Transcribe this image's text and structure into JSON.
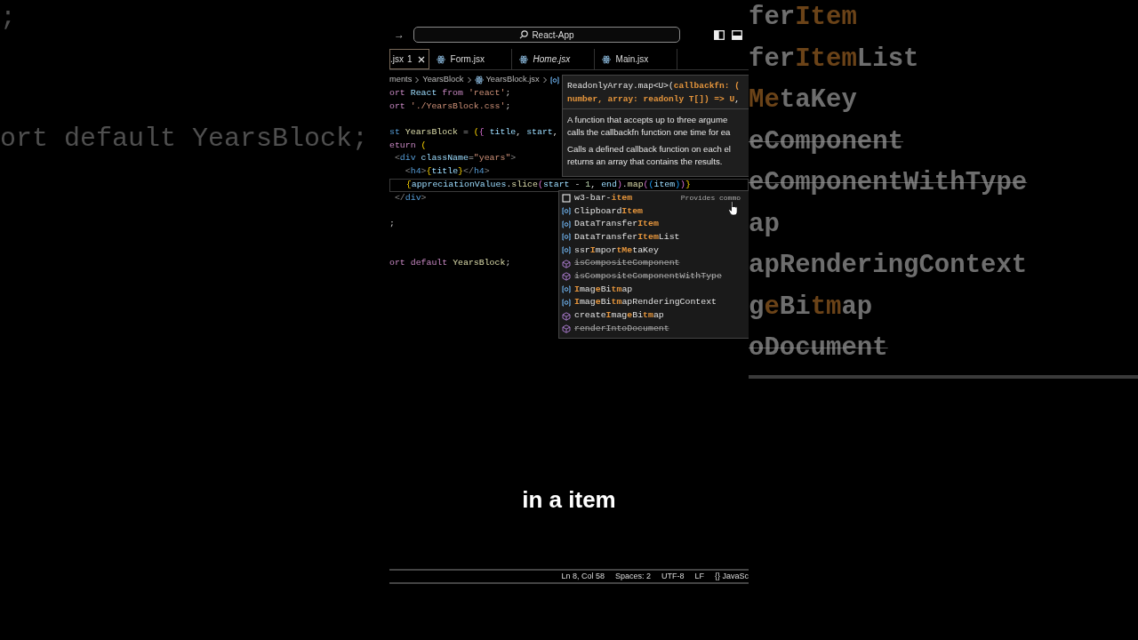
{
  "background_left": {
    "lines": [
      ";",
      "ort default YearsBlock;"
    ]
  },
  "background_right": {
    "lines": [
      {
        "segments": [
          {
            "text": "fer"
          },
          {
            "text": "Item",
            "match": true
          }
        ]
      },
      {
        "segments": [
          {
            "text": "fer"
          },
          {
            "text": "Item",
            "match": true
          },
          {
            "text": "List"
          }
        ]
      },
      {
        "segments": [
          {
            "text": "Me",
            "match": true
          },
          {
            "text": "taKey"
          }
        ]
      },
      {
        "segments": [
          {
            "text": "eComponent"
          }
        ],
        "deprecated": true
      },
      {
        "segments": [
          {
            "text": "eComponentWithType"
          }
        ],
        "deprecated": true
      },
      {
        "segments": [
          {
            "text": "ap"
          }
        ]
      },
      {
        "segments": [
          {
            "text": "apRenderingContext"
          }
        ]
      },
      {
        "segments": [
          {
            "text": "g"
          },
          {
            "text": "e",
            "match": true
          },
          {
            "text": "Bi"
          },
          {
            "text": "tm",
            "match": true
          },
          {
            "text": "ap"
          }
        ]
      },
      {
        "segments": [
          {
            "text": "oDocument"
          }
        ],
        "deprecated": true
      }
    ]
  },
  "title_bar": {
    "back": "→",
    "search": "React-App"
  },
  "tabs": [
    {
      "label": ".jsx",
      "problems": "1",
      "selected": true
    },
    {
      "label": "Form.jsx",
      "selected": false
    },
    {
      "label": "Home.jsx",
      "selected": false,
      "preview": true
    },
    {
      "label": "Main.jsx",
      "selected": false
    }
  ],
  "breadcrumb": [
    {
      "text": "ments"
    },
    {
      "text": "YearsBlock"
    },
    {
      "text": "YearsBlock.jsx",
      "kind": "file"
    }
  ],
  "code": [
    {
      "kind": "code",
      "segments": [
        {
          "kind": "control",
          "text": "ort"
        },
        {
          "kind": "variable",
          "text": " React"
        },
        {
          "kind": "control",
          "text": " from"
        },
        {
          "kind": "string",
          "text": " 'react'"
        },
        {
          "kind": "plain",
          "text": ";"
        }
      ]
    },
    {
      "kind": "code",
      "segments": [
        {
          "kind": "control",
          "text": "ort"
        },
        {
          "kind": "string",
          "text": " './YearsBlock.css'"
        },
        {
          "kind": "plain",
          "text": ";"
        }
      ]
    },
    {
      "kind": "blank"
    },
    {
      "kind": "code",
      "segments": [
        {
          "kind": "keyword",
          "text": "st"
        },
        {
          "kind": "function",
          "text": " YearsBlock"
        },
        {
          "kind": "plain",
          "text": " ="
        },
        {
          "kind": "bracket",
          "text": " ("
        },
        {
          "kind": "brace",
          "text": "{"
        },
        {
          "kind": "variable",
          "text": " title"
        },
        {
          "kind": "plain",
          "text": ","
        },
        {
          "kind": "variable",
          "text": " start"
        },
        {
          "kind": "plain",
          "text": ","
        }
      ]
    },
    {
      "kind": "code",
      "segments": [
        {
          "kind": "control",
          "text": "eturn"
        },
        {
          "kind": "bracket",
          "text": " ("
        }
      ]
    },
    {
      "kind": "code",
      "segments": [
        {
          "kind": "punct",
          "text": " <"
        },
        {
          "kind": "tag",
          "text": "div"
        },
        {
          "kind": "variable",
          "text": " className"
        },
        {
          "kind": "plain",
          "text": "="
        },
        {
          "kind": "string",
          "text": "\"years\""
        },
        {
          "kind": "punct",
          "text": ">"
        }
      ]
    },
    {
      "kind": "code",
      "segments": [
        {
          "kind": "punct",
          "text": "   <"
        },
        {
          "kind": "tag",
          "text": "h4"
        },
        {
          "kind": "punct",
          "text": ">"
        },
        {
          "kind": "bracket",
          "text": "{"
        },
        {
          "kind": "variable",
          "text": "title"
        },
        {
          "kind": "bracket",
          "text": "}"
        },
        {
          "kind": "punct",
          "text": "</"
        },
        {
          "kind": "tag",
          "text": "h4"
        },
        {
          "kind": "punct",
          "text": ">"
        }
      ]
    },
    {
      "kind": "code",
      "current": true,
      "segments": [
        {
          "kind": "bracket",
          "text": "   {"
        },
        {
          "kind": "variable",
          "text": "appreciationValues"
        },
        {
          "kind": "plain",
          "text": "."
        },
        {
          "kind": "function",
          "text": "slice"
        },
        {
          "kind": "brace",
          "text": "("
        },
        {
          "kind": "variable",
          "text": "start"
        },
        {
          "kind": "plain",
          "text": " -"
        },
        {
          "kind": "number",
          "text": " 1"
        },
        {
          "kind": "plain",
          "text": ","
        },
        {
          "kind": "variable",
          "text": " end"
        },
        {
          "kind": "brace",
          "text": ")"
        },
        {
          "kind": "plain",
          "text": "."
        },
        {
          "kind": "function",
          "text": "map"
        },
        {
          "kind": "brace",
          "text": "("
        },
        {
          "kind": "paren",
          "text": "("
        },
        {
          "kind": "variable",
          "text": "item"
        },
        {
          "kind": "paren",
          "text": ")"
        },
        {
          "kind": "brace",
          "text": ")"
        },
        {
          "kind": "bracket",
          "text": "}"
        }
      ]
    },
    {
      "kind": "code",
      "segments": [
        {
          "kind": "punct",
          "text": " </"
        },
        {
          "kind": "tag",
          "text": "div"
        },
        {
          "kind": "punct",
          "text": ">"
        }
      ]
    },
    {
      "kind": "blank"
    },
    {
      "kind": "code",
      "segments": [
        {
          "kind": "plain",
          "text": ";"
        }
      ]
    },
    {
      "kind": "blank"
    },
    {
      "kind": "blank"
    },
    {
      "kind": "code",
      "segments": [
        {
          "kind": "control",
          "text": "ort"
        },
        {
          "kind": "control",
          "text": " default"
        },
        {
          "kind": "function",
          "text": " YearsBlock"
        },
        {
          "kind": "plain",
          "text": ";"
        }
      ]
    }
  ],
  "hover": {
    "signature": [
      [
        {
          "text": "ReadonlyArray.map<U>("
        },
        {
          "text": "callbackfn: (",
          "active": true
        }
      ],
      [
        {
          "text": "number, array: readonly T[]) => U",
          "active": true
        },
        {
          "text": ","
        }
      ]
    ],
    "paragraphs": [
      {
        "lines": [
          "A function that accepts up to three argume",
          "calls the callbackfn function one time for ea"
        ]
      },
      {
        "lines": [
          "Calls a defined callback function on each el",
          "returns an array that contains the results."
        ]
      }
    ]
  },
  "suggestions": [
    {
      "kind": "css",
      "segments": [
        {
          "text": "w3-bar-"
        },
        {
          "text": "item",
          "match": true
        }
      ],
      "detail": "Provides commo",
      "deprecated": false
    },
    {
      "kind": "variable",
      "segments": [
        {
          "text": "Clipboard"
        },
        {
          "text": "Item",
          "match": true
        }
      ],
      "deprecated": false
    },
    {
      "kind": "variable",
      "segments": [
        {
          "text": "DataTransfer"
        },
        {
          "text": "Item",
          "match": true
        }
      ],
      "deprecated": false
    },
    {
      "kind": "variable",
      "segments": [
        {
          "text": "DataTransfer"
        },
        {
          "text": "Item",
          "match": true
        },
        {
          "text": "List"
        }
      ],
      "deprecated": false
    },
    {
      "kind": "variable",
      "segments": [
        {
          "text": "ssr"
        },
        {
          "text": "I",
          "match": true
        },
        {
          "text": "mpor"
        },
        {
          "text": "tMe",
          "match": true
        },
        {
          "text": "taKey"
        }
      ],
      "deprecated": false
    },
    {
      "kind": "module",
      "segments": [
        {
          "text": "isCompositeComponent"
        }
      ],
      "deprecated": true
    },
    {
      "kind": "module",
      "segments": [
        {
          "text": "isCompositeComponentWithType"
        }
      ],
      "deprecated": true
    },
    {
      "kind": "variable",
      "segments": [
        {
          "text": "I",
          "match": true
        },
        {
          "text": "mag"
        },
        {
          "text": "e",
          "match": true
        },
        {
          "text": "Bi"
        },
        {
          "text": "tm",
          "match": true
        },
        {
          "text": "ap"
        }
      ],
      "deprecated": false
    },
    {
      "kind": "variable",
      "segments": [
        {
          "text": "I",
          "match": true
        },
        {
          "text": "mag"
        },
        {
          "text": "e",
          "match": true
        },
        {
          "text": "Bi"
        },
        {
          "text": "tm",
          "match": true
        },
        {
          "text": "apRenderingContext"
        }
      ],
      "deprecated": false
    },
    {
      "kind": "module",
      "segments": [
        {
          "text": "create"
        },
        {
          "text": "I",
          "match": true
        },
        {
          "text": "mag"
        },
        {
          "text": "e",
          "match": true
        },
        {
          "text": "Bi"
        },
        {
          "text": "tm",
          "match": true
        },
        {
          "text": "ap"
        }
      ],
      "deprecated": false
    },
    {
      "kind": "module",
      "segments": [
        {
          "text": "renderIntoDocument"
        }
      ],
      "deprecated": true
    }
  ],
  "caption": "in a item",
  "status_bar": [
    "Ln 8, Col 58",
    "Spaces: 2",
    "UTF-8",
    "LF",
    "{} JavaSc"
  ]
}
